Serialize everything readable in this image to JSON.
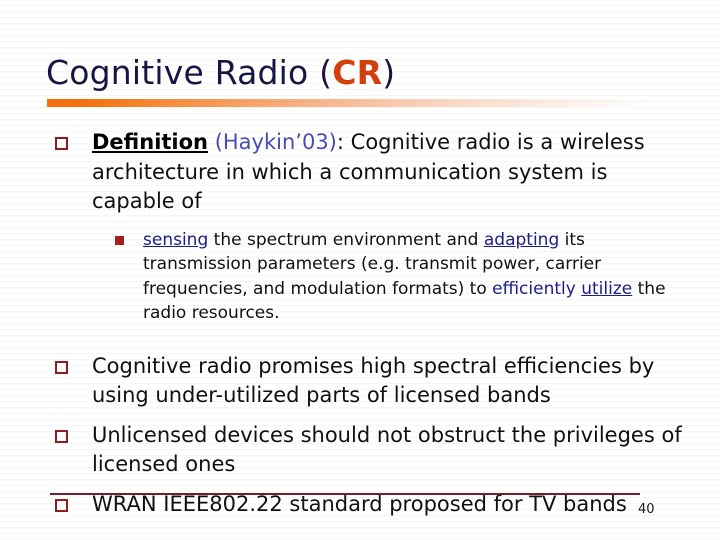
{
  "slide": {
    "title": {
      "main": "Cognitive Radio (",
      "accent": "CR",
      "tail": ")",
      "full": "Cognitive Radio (CR)",
      "color": "#161644",
      "accent_color": "#d4400c"
    },
    "divider": {
      "gradient_start": "#f4710d",
      "gradient_end": "#ffffff"
    },
    "bullets": [
      {
        "marker": "hollow-square",
        "marker_color": "#8f1d24",
        "lead_label": "Definition",
        "citation": "(Haykin’03)",
        "separator": ": ",
        "text": "Cognitive radio is a wireless architecture in which a communication system is capable of",
        "sub_bullets": [
          {
            "marker": "filled-square",
            "marker_color": "#a81f22",
            "seg1_keyword": "sensing",
            "seg2": " the spectrum environment and ",
            "seg3_keyword": "adapting",
            "seg4": " its transmission parameters (e.g. transmit power, carrier frequencies, and modulation formats) to ",
            "seg5_keyword_plain": "efficiently ",
            "seg6_keyword": "utilize",
            "seg7": " the radio resources."
          }
        ]
      },
      {
        "marker": "hollow-square",
        "marker_color": "#8f1d24",
        "text": "Cognitive radio promises high spectral efficiencies by using under-utilized parts of licensed bands"
      },
      {
        "marker": "hollow-square",
        "marker_color": "#8f1d24",
        "text": "Unlicensed devices should not obstruct the privileges of licensed ones"
      },
      {
        "marker": "hollow-square",
        "marker_color": "#8f1d24",
        "text": "WRAN IEEE802.22 standard proposed for TV bands"
      }
    ],
    "footer": {
      "page_number": "40",
      "rule_color": "#6e1f2a"
    }
  }
}
